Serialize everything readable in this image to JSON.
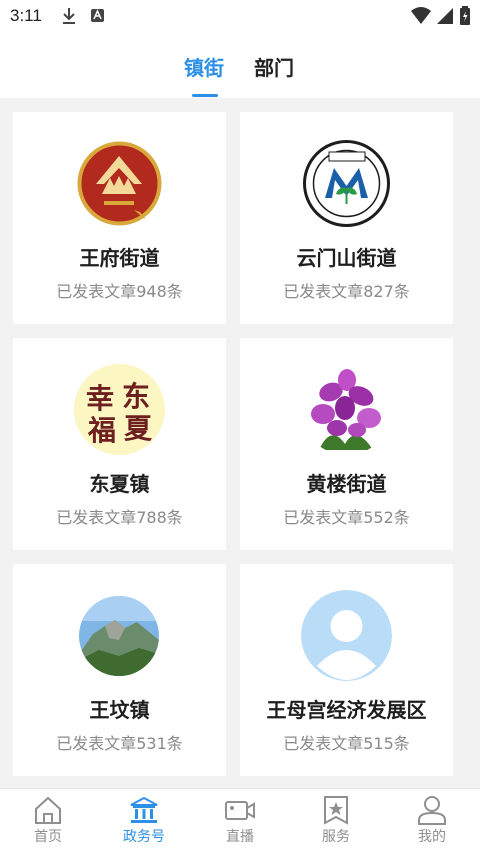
{
  "status_bar": {
    "time": "3:11"
  },
  "tabs": [
    {
      "label": "镇街",
      "active": true
    },
    {
      "label": "部门",
      "active": false
    }
  ],
  "cards": [
    {
      "name": "王府街道",
      "count": "已发表文章948条",
      "logo_icon": "wangfu-emblem-icon"
    },
    {
      "name": "云门山街道",
      "count": "已发表文章827条",
      "logo_icon": "yunmenshan-emblem-icon"
    },
    {
      "name": "东夏镇",
      "count": "已发表文章788条",
      "logo_icon": "dongxia-calligraphy-icon",
      "logo_text": [
        "幸",
        "东",
        "福",
        "夏"
      ]
    },
    {
      "name": "黄楼街道",
      "count": "已发表文章552条",
      "logo_icon": "purple-flower-icon"
    },
    {
      "name": "王坟镇",
      "count": "已发表文章531条",
      "logo_icon": "mountain-photo-icon"
    },
    {
      "name": "王母宫经济发展区",
      "count": "已发表文章515条",
      "logo_icon": "default-avatar-icon"
    }
  ],
  "bottom_nav": [
    {
      "label": "首页",
      "icon": "home-icon",
      "active": false
    },
    {
      "label": "政务号",
      "icon": "government-building-icon",
      "active": true
    },
    {
      "label": "直播",
      "icon": "video-camera-icon",
      "active": false
    },
    {
      "label": "服务",
      "icon": "bookmark-star-icon",
      "active": false
    },
    {
      "label": "我的",
      "icon": "user-icon",
      "active": false
    }
  ],
  "colors": {
    "accent": "#2e8fe6",
    "inactive": "#8f8f8f",
    "background": "#f2f2f2"
  }
}
